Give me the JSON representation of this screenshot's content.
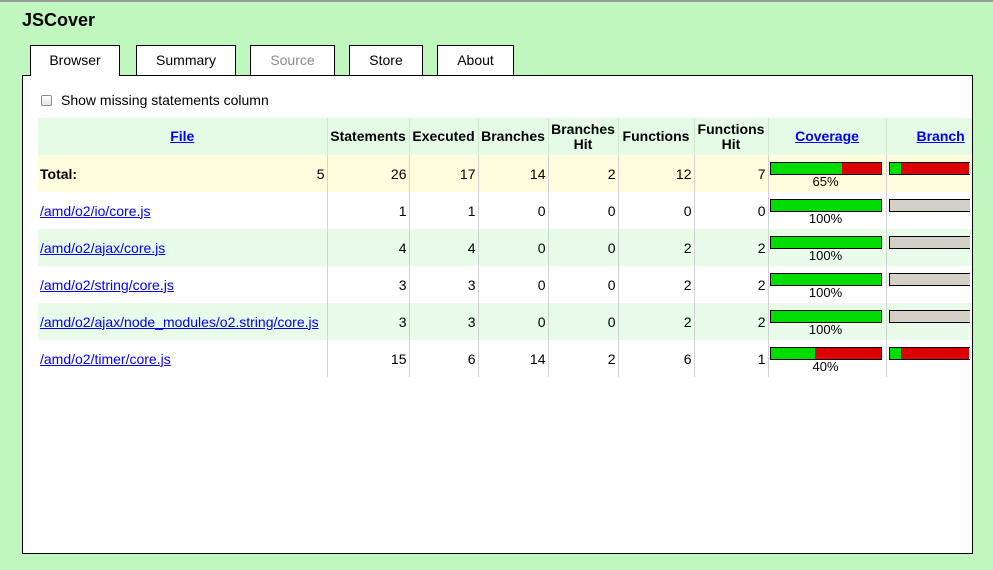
{
  "app": {
    "title": "JSCover"
  },
  "tabs": [
    {
      "label": "Browser",
      "state": "active"
    },
    {
      "label": "Summary",
      "state": "normal"
    },
    {
      "label": "Source",
      "state": "disabled"
    },
    {
      "label": "Store",
      "state": "normal"
    },
    {
      "label": "About",
      "state": "normal"
    }
  ],
  "options": {
    "missing_statements_label": "Show missing statements column",
    "missing_statements_checked": false
  },
  "table": {
    "headers": {
      "file": "File",
      "statements": "Statements",
      "executed": "Executed",
      "branches": "Branches",
      "branches_hit": "Branches Hit",
      "functions": "Functions",
      "functions_hit": "Functions Hit",
      "coverage": "Coverage",
      "branch": "Branch"
    },
    "total": {
      "label": "Total:",
      "file_count": "5",
      "statements": "26",
      "executed": "17",
      "branches": "14",
      "branches_hit": "2",
      "functions": "12",
      "functions_hit": "7",
      "coverage_text": "65%",
      "coverage_fraction": 0.65,
      "branch_fraction": 0.14
    },
    "rows": [
      {
        "file": "/amd/o2/io/core.js",
        "statements": "1",
        "executed": "1",
        "branches": "0",
        "branches_hit": "0",
        "functions": "0",
        "functions_hit": "0",
        "coverage_text": "100%",
        "coverage_fraction": 1.0,
        "branch_fraction": null
      },
      {
        "file": "/amd/o2/ajax/core.js",
        "statements": "4",
        "executed": "4",
        "branches": "0",
        "branches_hit": "0",
        "functions": "2",
        "functions_hit": "2",
        "coverage_text": "100%",
        "coverage_fraction": 1.0,
        "branch_fraction": null
      },
      {
        "file": "/amd/o2/string/core.js",
        "statements": "3",
        "executed": "3",
        "branches": "0",
        "branches_hit": "0",
        "functions": "2",
        "functions_hit": "2",
        "coverage_text": "100%",
        "coverage_fraction": 1.0,
        "branch_fraction": null
      },
      {
        "file": "/amd/o2/ajax/node_modules/o2.string/core.js",
        "statements": "3",
        "executed": "3",
        "branches": "0",
        "branches_hit": "0",
        "functions": "2",
        "functions_hit": "2",
        "coverage_text": "100%",
        "coverage_fraction": 1.0,
        "branch_fraction": null
      },
      {
        "file": "/amd/o2/timer/core.js",
        "statements": "15",
        "executed": "6",
        "branches": "14",
        "branches_hit": "2",
        "functions": "6",
        "functions_hit": "1",
        "coverage_text": "40%",
        "coverage_fraction": 0.4,
        "branch_fraction": 0.14
      }
    ]
  },
  "colors": {
    "background": "#bff7bf",
    "covered": "#00dd00",
    "uncovered": "#dd0000",
    "no_branches": "#d4d0c8",
    "link": "#0000ee"
  }
}
